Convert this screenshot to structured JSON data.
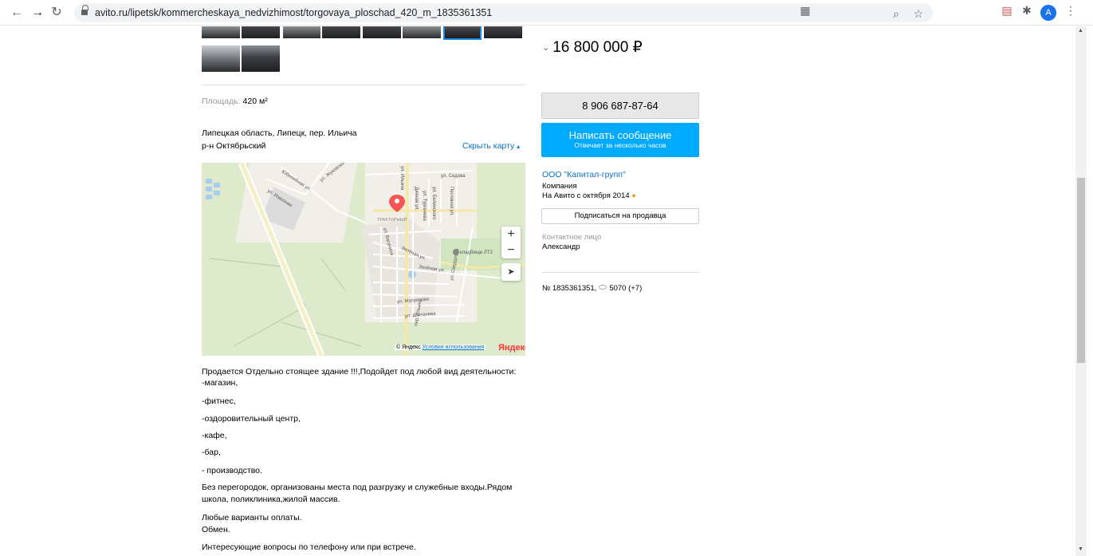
{
  "browser": {
    "url": "avito.ru/lipetsk/kommercheskaya_nedvizhimost/torgovaya_ploschad_420_m_1835361351",
    "avatar_letter": "A"
  },
  "listing": {
    "area_label": "Площадь:",
    "area_value": "420 м²",
    "address_line": "Липецкая область, Липецк, пер. Ильича",
    "district": "р-н Октябрьский",
    "hide_map": "Скрыть карту",
    "map": {
      "streets": [
        "ул. Жуковского",
        "Юбилейная ул.",
        "ул. Извозная",
        "ул. Ильича",
        "ул. Седова",
        "Дачная ул.",
        "ул. Тургенева",
        "ул. Белинского",
        "Песчаная ул.",
        "ТРАКТОРНЫЙ",
        "ул. Вагунина",
        "Зелёная ул.",
        "Зелёная ул.",
        "кладбище ЛТЗ",
        "ул. Матросова",
        "ул. Доктачева",
        "ул. Свердлова",
        "пер. Ильича"
      ],
      "copyright": "© Яндекс",
      "terms": "Условия использования",
      "logo": "Яндекс"
    },
    "description": [
      "Продается Отдельно стоящее здание !!!,Подойдет под любой вид деятельности:",
      "-магазин,",
      "-фитнес,",
      "-оздоровительный центр,",
      "-кафе,",
      "-бар,",
      "- производство.",
      "Без перегородок, организованы места под разгрузку и служебные входы.Рядом",
      "школа, поликлиника,жилой массив.",
      "Любые варианты оплаты.",
      "Обмен.",
      "Интересующие вопросы по телефону или при встрече."
    ]
  },
  "sidebar": {
    "price": "16 800 000 ₽",
    "phone": "8 906 687-87-64",
    "message_button": "Написать сообщение",
    "message_sub": "Отвечает за несколько часов",
    "seller_name": "ООО \"Капитал-групп\"",
    "seller_type": "Компания",
    "seller_since": "На Авито с октября 2014",
    "subscribe": "Подписаться на продавца",
    "contact_label": "Контактное лицо",
    "contact_name": "Александр",
    "ad_number": "№ 1835361351,",
    "views": "5070 (+7)"
  },
  "colors": {
    "accent_blue": "#00aaff",
    "link": "#0a71c9",
    "map_pin": "#f55555"
  }
}
